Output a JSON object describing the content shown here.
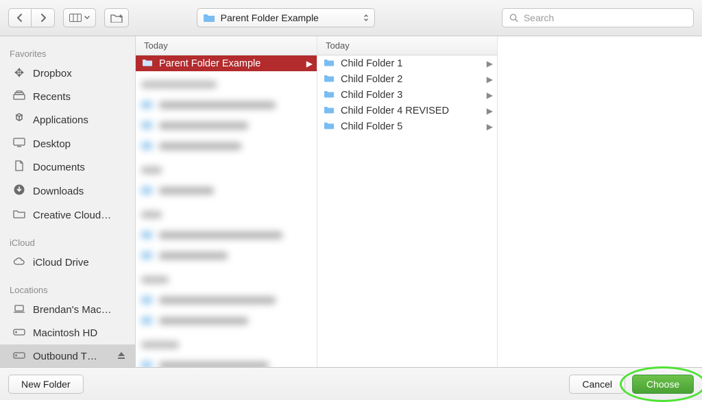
{
  "toolbar": {
    "current_folder": "Parent Folder Example",
    "search_placeholder": "Search"
  },
  "sidebar": {
    "sections": [
      {
        "title": "Favorites",
        "items": [
          {
            "icon": "dropbox",
            "label": "Dropbox"
          },
          {
            "icon": "recents",
            "label": "Recents"
          },
          {
            "icon": "apps",
            "label": "Applications"
          },
          {
            "icon": "desktop",
            "label": "Desktop"
          },
          {
            "icon": "docs",
            "label": "Documents"
          },
          {
            "icon": "downloads",
            "label": "Downloads"
          },
          {
            "icon": "folder",
            "label": "Creative Cloud…"
          }
        ]
      },
      {
        "title": "iCloud",
        "items": [
          {
            "icon": "cloud",
            "label": "iCloud Drive"
          }
        ]
      },
      {
        "title": "Locations",
        "items": [
          {
            "icon": "laptop",
            "label": "Brendan's Mac…"
          },
          {
            "icon": "hdd",
            "label": "Macintosh HD"
          },
          {
            "icon": "ext",
            "label": "Outbound T…",
            "eject": true,
            "selected": true
          }
        ]
      }
    ]
  },
  "column1": {
    "header": "Today",
    "selected": {
      "label": "Parent Folder Example"
    }
  },
  "column2": {
    "header": "Today",
    "items": [
      {
        "label": "Child Folder 1"
      },
      {
        "label": "Child Folder 2"
      },
      {
        "label": "Child Folder 3"
      },
      {
        "label": "Child Folder 4 REVISED"
      },
      {
        "label": "Child Folder 5"
      }
    ]
  },
  "footer": {
    "new_folder": "New Folder",
    "cancel": "Cancel",
    "choose": "Choose"
  }
}
